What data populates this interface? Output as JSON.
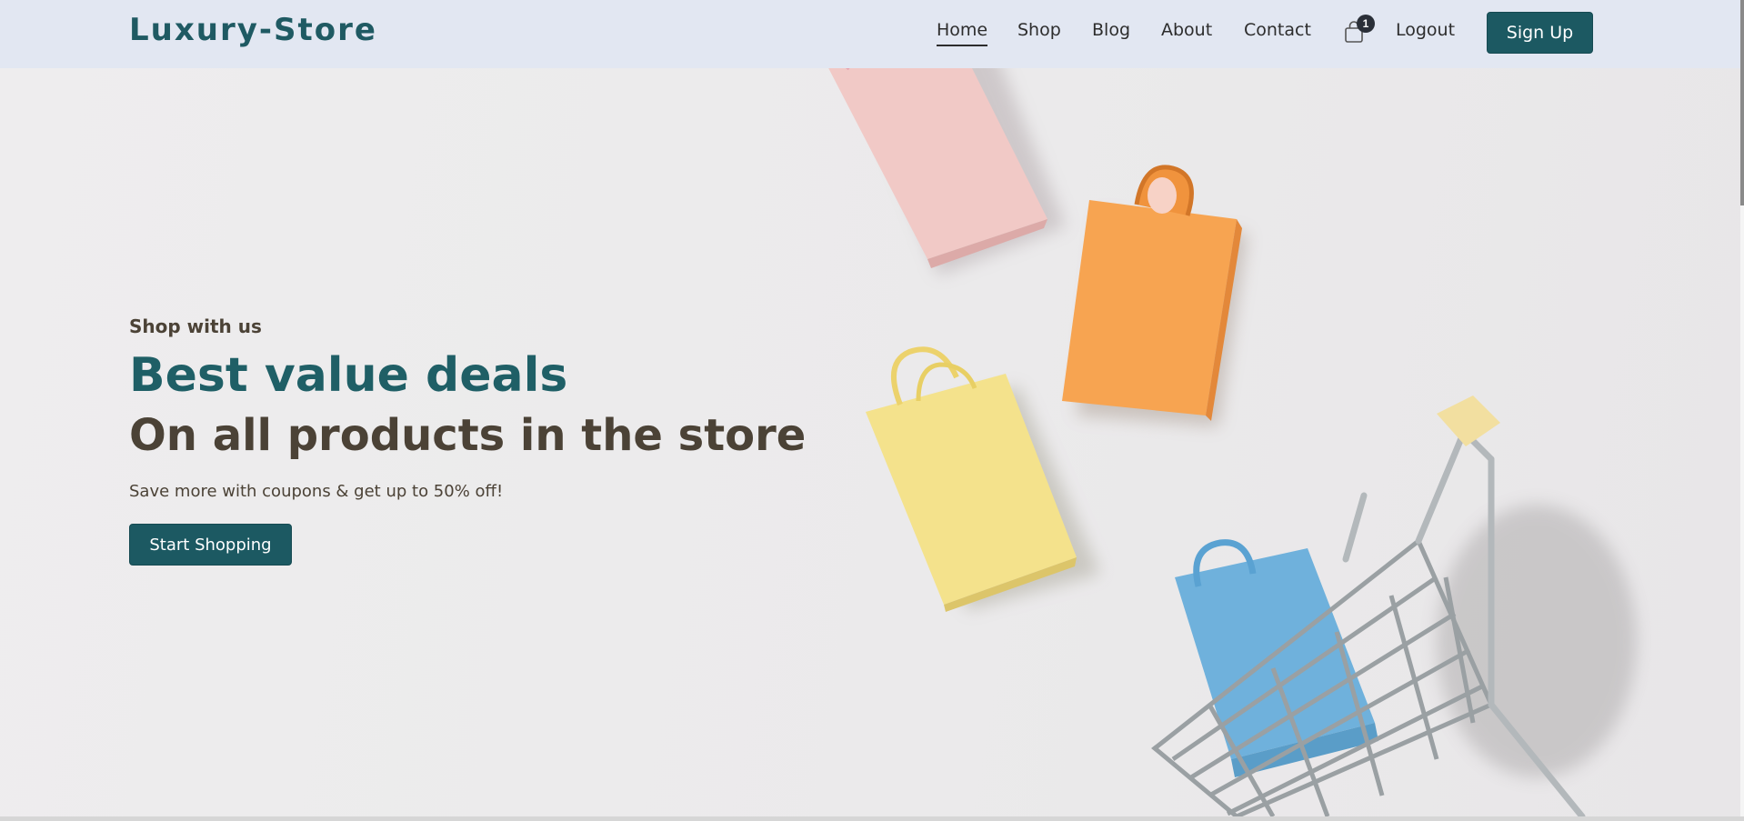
{
  "brand": {
    "logo_text": "Luxury-Store"
  },
  "nav": {
    "links": [
      {
        "label": "Home",
        "active": true
      },
      {
        "label": "Shop",
        "active": false
      },
      {
        "label": "Blog",
        "active": false
      },
      {
        "label": "About",
        "active": false
      },
      {
        "label": "Contact",
        "active": false
      }
    ],
    "cart": {
      "icon": "shopping-bag-icon",
      "count": "1"
    },
    "logout_label": "Logout",
    "signup_label": "Sign Up"
  },
  "hero": {
    "eyebrow": "Shop with us",
    "headline": "Best value deals",
    "subheadline": "On all products in the store",
    "tagline": "Save more with coupons & get up to 50% off!",
    "cta_label": "Start Shopping",
    "image": "shopping-bags-and-cart-illustration"
  },
  "colors": {
    "navbar_bg": "#e2e7f2",
    "accent": "#1c5962",
    "headline": "#1f5f66",
    "text_dark": "#4b4236"
  }
}
